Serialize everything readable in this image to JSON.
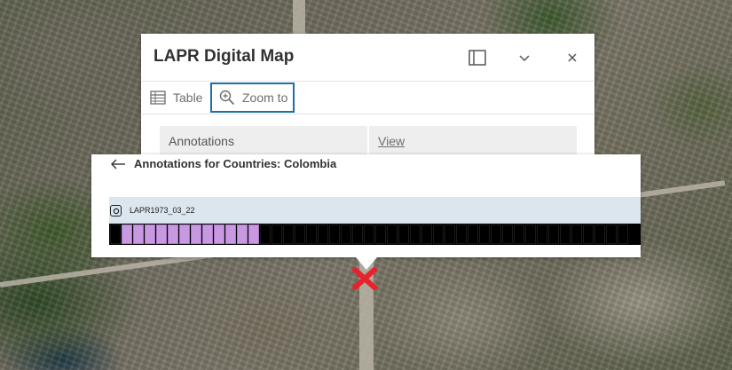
{
  "popup": {
    "title": "LAPR Digital Map",
    "dock_icon": "dock-icon",
    "collapse_icon": "chevron-down-icon",
    "close_icon": "close-icon",
    "toolbar": {
      "table_label": "Table",
      "zoom_label": "Zoom to"
    },
    "attributes": [
      {
        "key": "Annotations",
        "value": "View"
      }
    ]
  },
  "annotations_panel": {
    "title": "Annotations for Countries: Colombia",
    "back_icon": "arrow-left-icon",
    "image_id": "LAPR1973_03_22",
    "frame_count": 45,
    "active_frames": [
      1,
      2,
      3,
      4,
      5,
      6,
      7,
      8,
      9,
      10,
      11,
      12
    ]
  },
  "colors": {
    "accent": "#1d6fa8",
    "frame_active": "#c898e0",
    "strip_bg": "#dce6ee",
    "marker": "#e8222c"
  }
}
